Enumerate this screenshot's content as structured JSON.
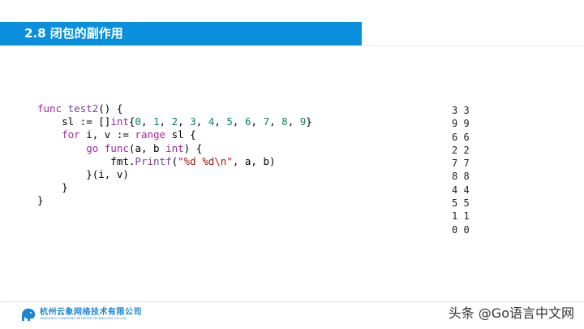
{
  "slide": {
    "title": "2.8 闭包的副作用",
    "code_lines": [
      [
        {
          "t": "func ",
          "c": "kw"
        },
        {
          "t": "test2",
          "c": "fn"
        },
        {
          "t": "() {",
          "c": ""
        }
      ],
      [
        {
          "t": "    sl := []",
          "c": ""
        },
        {
          "t": "int",
          "c": "ty"
        },
        {
          "t": "{",
          "c": ""
        },
        {
          "t": "0",
          "c": "num"
        },
        {
          "t": ", ",
          "c": ""
        },
        {
          "t": "1",
          "c": "num"
        },
        {
          "t": ", ",
          "c": ""
        },
        {
          "t": "2",
          "c": "num"
        },
        {
          "t": ", ",
          "c": ""
        },
        {
          "t": "3",
          "c": "num"
        },
        {
          "t": ", ",
          "c": ""
        },
        {
          "t": "4",
          "c": "num"
        },
        {
          "t": ", ",
          "c": ""
        },
        {
          "t": "5",
          "c": "num"
        },
        {
          "t": ", ",
          "c": ""
        },
        {
          "t": "6",
          "c": "num"
        },
        {
          "t": ", ",
          "c": ""
        },
        {
          "t": "7",
          "c": "num"
        },
        {
          "t": ", ",
          "c": ""
        },
        {
          "t": "8",
          "c": "num"
        },
        {
          "t": ", ",
          "c": ""
        },
        {
          "t": "9",
          "c": "num"
        },
        {
          "t": "}",
          "c": ""
        }
      ],
      [
        {
          "t": "    ",
          "c": ""
        },
        {
          "t": "for",
          "c": "kw"
        },
        {
          "t": " i, v := ",
          "c": ""
        },
        {
          "t": "range",
          "c": "kw"
        },
        {
          "t": " sl {",
          "c": ""
        }
      ],
      [
        {
          "t": "        ",
          "c": ""
        },
        {
          "t": "go",
          "c": "kw"
        },
        {
          "t": " ",
          "c": ""
        },
        {
          "t": "func",
          "c": "kw"
        },
        {
          "t": "(a, b ",
          "c": ""
        },
        {
          "t": "int",
          "c": "ty"
        },
        {
          "t": ") {",
          "c": ""
        }
      ],
      [
        {
          "t": "            fmt.",
          "c": ""
        },
        {
          "t": "Printf",
          "c": "fn"
        },
        {
          "t": "(",
          "c": ""
        },
        {
          "t": "\"%d %d\\n\"",
          "c": "str"
        },
        {
          "t": ", a, b)",
          "c": ""
        }
      ],
      [
        {
          "t": "        }(i, v)",
          "c": ""
        }
      ],
      [
        {
          "t": "    }",
          "c": ""
        }
      ],
      [
        {
          "t": "}",
          "c": ""
        }
      ]
    ],
    "output_lines": [
      "3 3",
      "9 9",
      "6 6",
      "2 2",
      "7 7",
      "8 8",
      "4 4",
      "5 5",
      "1 1",
      "0 0"
    ],
    "logo": {
      "name_cn": "杭州云象网络技术有限公司",
      "name_en": "HANGZHOU YUNPHANT NETWORK TECHNOLOGY CO.,LTD",
      "color": "#1c86d1"
    },
    "watermark": "头条 @Go语言中文网",
    "accent_color": "#0a8fdc"
  }
}
